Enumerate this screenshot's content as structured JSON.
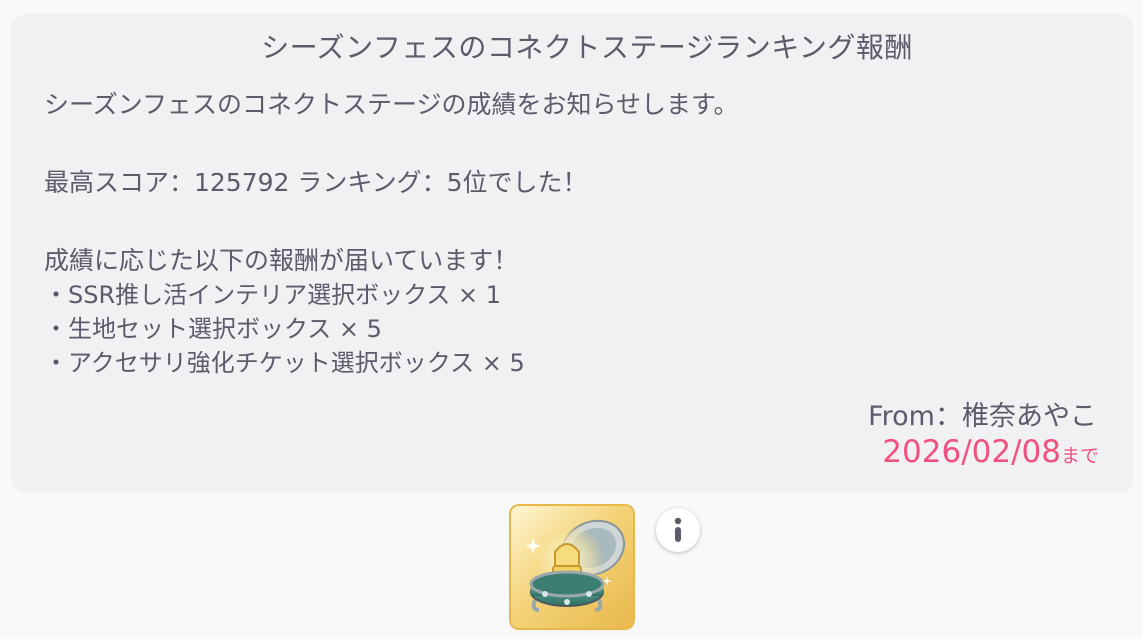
{
  "mail": {
    "title": "シーズンフェスのコネクトステージランキング報酬",
    "lines": [
      "シーズンフェスのコネクトステージの成績をお知らせします。",
      "最高スコア：125792 ランキング：5位でした！",
      "成績に応じた以下の報酬が届いています！"
    ],
    "rewards": [
      "・SSR推し活インテリア選択ボックス × 1",
      "・生地セット選択ボックス × 5",
      "・アクセサリ強化チケット選択ボックス × 5"
    ],
    "from": "From：椎奈あやこ",
    "deadline_date": "2026/02/08",
    "deadline_suffix": "まで"
  },
  "reward_item": {
    "icon": "jewelry-box-icon"
  },
  "info_icon": "info-icon",
  "colors": {
    "text": "#5d5a6a",
    "deadline": "#f0527f",
    "card_bg": "#f1f1f4",
    "tile_gold": "#e8b94c"
  }
}
